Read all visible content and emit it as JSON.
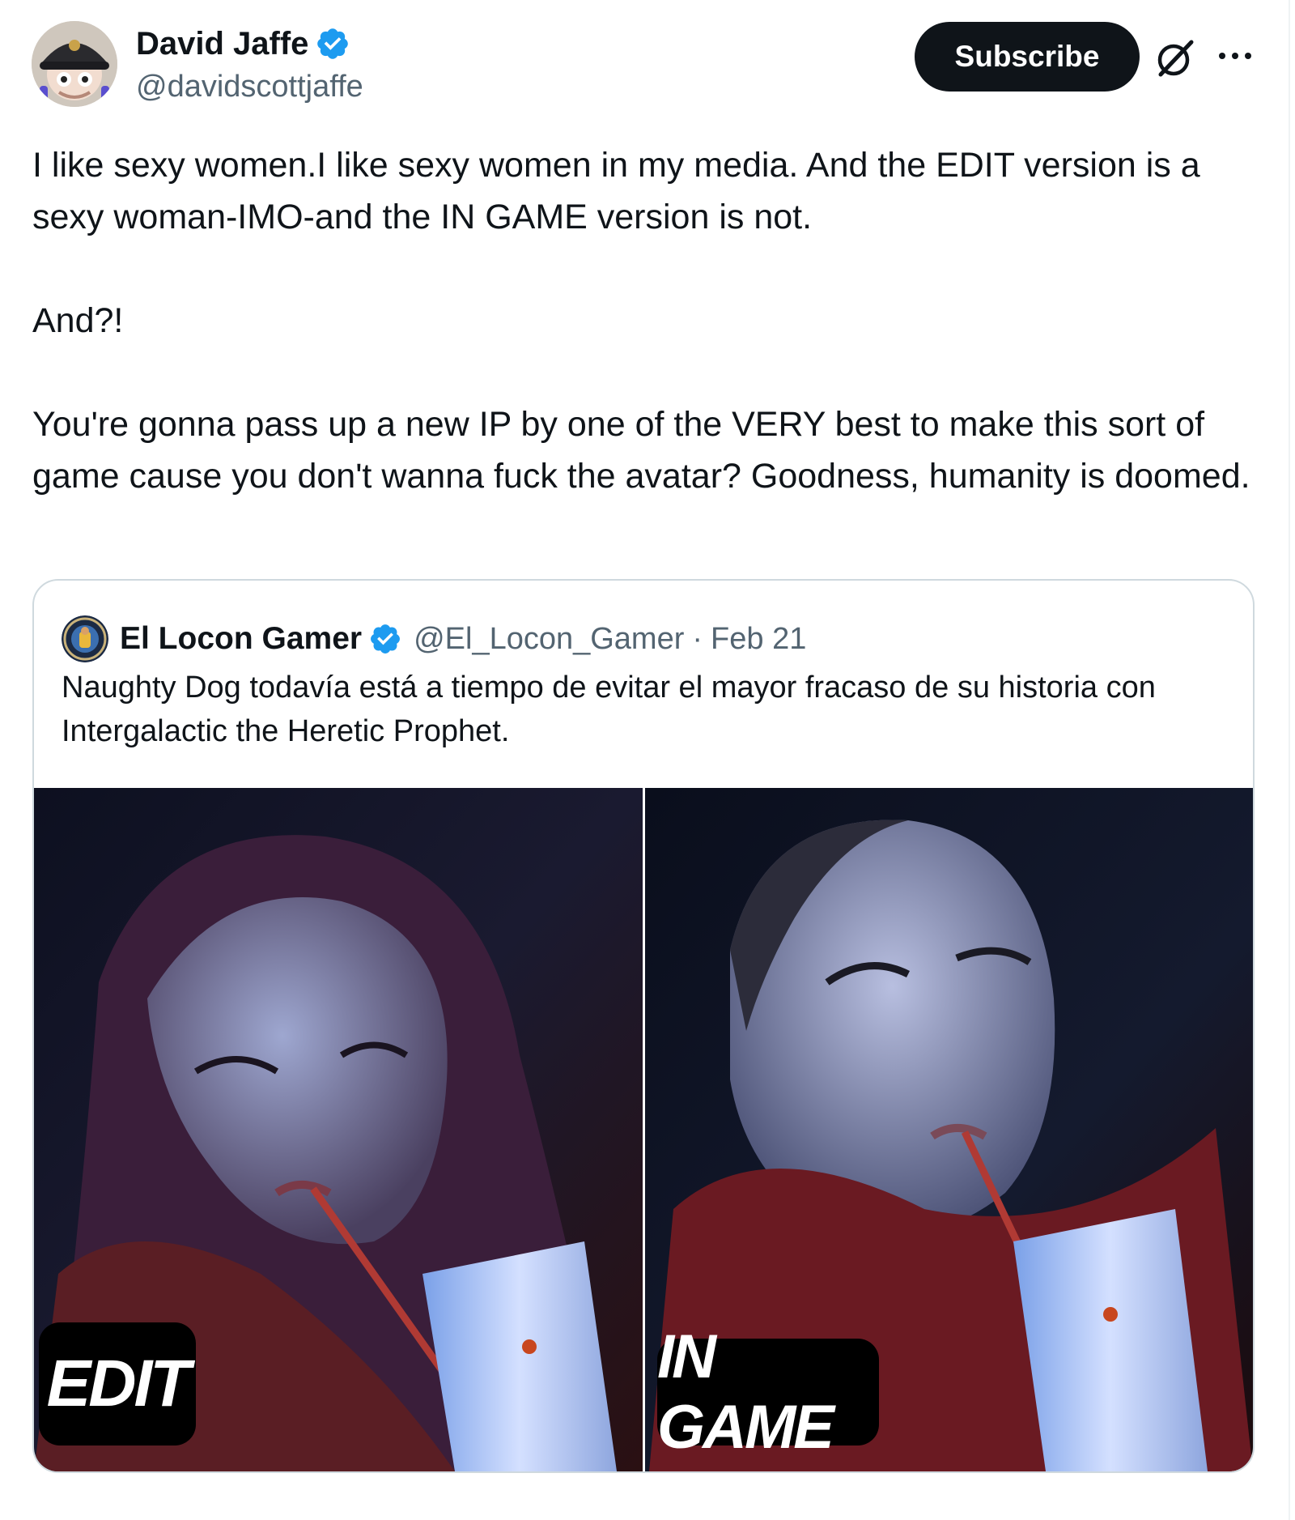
{
  "author": {
    "display_name": "David Jaffe",
    "handle": "@davidscottjaffe",
    "verified": true,
    "verified_color": "#1d9bf0"
  },
  "actions": {
    "subscribe_label": "Subscribe",
    "grok_icon": "grok-icon",
    "more_icon": "more-horizontal-icon"
  },
  "tweet": {
    "text": "I like sexy women.I like sexy women in my media. And the EDIT version is a sexy woman-IMO-and the IN GAME version is not.\n\nAnd?!\n\nYou're gonna pass up a new IP by one of the VERY best to make this sort of game cause you don't wanna fuck the avatar? Goodness, humanity is doomed."
  },
  "quoted_tweet": {
    "display_name": "El Locon Gamer",
    "handle": "@El_Locon_Gamer",
    "separator": "·",
    "date": "Feb 21",
    "verified": true,
    "text": "Naughty Dog todavía está a tiempo de evitar el mayor fracaso de su historia con Intergalactic the Heretic Prophet.",
    "media": {
      "left_label": "EDIT",
      "right_label": "IN GAME"
    }
  }
}
